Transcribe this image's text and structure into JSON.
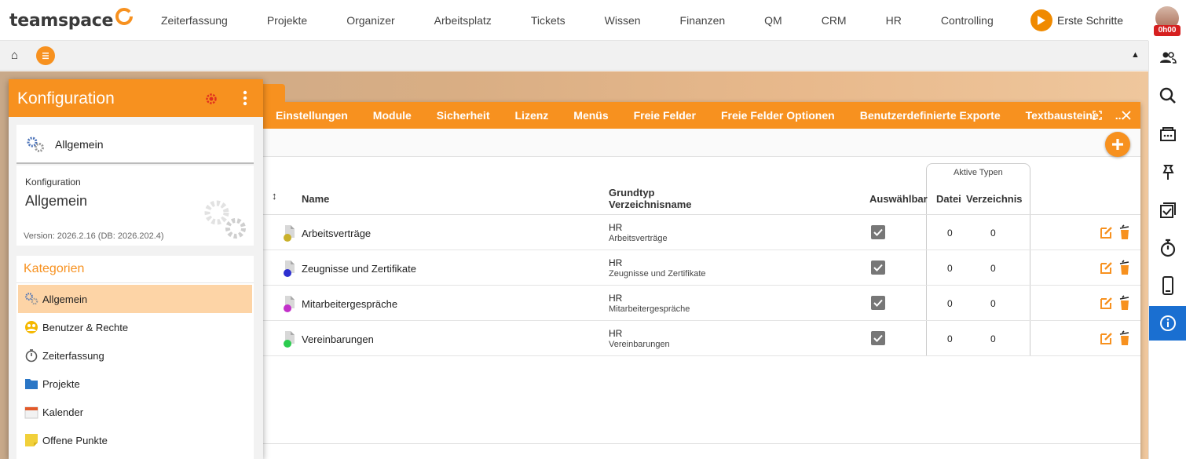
{
  "app": {
    "logo_text": "teamspace"
  },
  "nav": {
    "items": [
      "Zeiterfassung",
      "Projekte",
      "Organizer",
      "Arbeitsplatz",
      "Tickets",
      "Wissen",
      "Finanzen",
      "QM",
      "CRM",
      "HR",
      "Controlling"
    ],
    "erste_schritte": "Erste Schritte",
    "timer_badge": "0h00"
  },
  "subbar": {
    "home_icon": "⌂",
    "collapse_icon": "▲"
  },
  "window": {
    "tabs": [
      "Einstellungen",
      "Module",
      "Sicherheit",
      "Lizenz",
      "Menüs",
      "Freie Felder",
      "Freie Felder Optionen",
      "Benutzerdefinierte Exporte",
      "Textbausteine",
      "..."
    ],
    "table": {
      "headers": {
        "sort": "↕",
        "name": "Name",
        "grundtyp": "Grundtyp",
        "verzeichnisname": "Verzeichnisname",
        "auswaehlbar": "Auswählbar",
        "aktive_typen": "Aktive Typen",
        "datei": "Datei",
        "verzeichnis": "Verzeichnis"
      },
      "rows": [
        {
          "name": "Arbeitsverträge",
          "grundtyp": "HR",
          "verzeichnisname": "Arbeitsverträge",
          "datei": "0",
          "verzeichnis": "0",
          "dot_color": "#c9b02a"
        },
        {
          "name": "Zeugnisse und Zertifikate",
          "grundtyp": "HR",
          "verzeichnisname": "Zeugnisse und Zertifikate",
          "datei": "0",
          "verzeichnis": "0",
          "dot_color": "#2d2fd0"
        },
        {
          "name": "Mitarbeitergespräche",
          "grundtyp": "HR",
          "verzeichnisname": "Mitarbeitergespräche",
          "datei": "0",
          "verzeichnis": "0",
          "dot_color": "#c230c9"
        },
        {
          "name": "Vereinbarungen",
          "grundtyp": "HR",
          "verzeichnisname": "Vereinbarungen",
          "datei": "0",
          "verzeichnis": "0",
          "dot_color": "#2bcc4e"
        }
      ]
    }
  },
  "panel": {
    "title": "Konfiguration",
    "card1_label": "Allgemein",
    "card2_label": "Konfiguration",
    "card2_title": "Allgemein",
    "version": "Version: 2026.2.16 (DB: 2026.202.4)",
    "kategorien_title": "Kategorien",
    "kategorien": [
      {
        "label": "Allgemein",
        "icon": "gears-icon"
      },
      {
        "label": "Benutzer & Rechte",
        "icon": "users-icon"
      },
      {
        "label": "Zeiterfassung",
        "icon": "stopwatch-icon"
      },
      {
        "label": "Projekte",
        "icon": "folder-icon"
      },
      {
        "label": "Kalender",
        "icon": "calendar-icon"
      },
      {
        "label": "Offene Punkte",
        "icon": "sticky-note-icon"
      }
    ]
  },
  "colors": {
    "accent": "#f7911f",
    "active_blue": "#1a6fd1",
    "active_item": "#fdd4a6"
  }
}
